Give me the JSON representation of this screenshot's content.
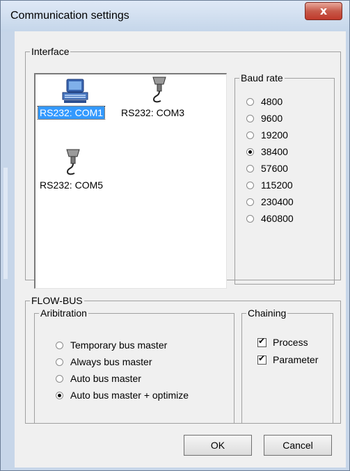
{
  "window": {
    "title": "Communication settings",
    "close_glyph": "x"
  },
  "interface": {
    "legend": "Interface",
    "devices": [
      {
        "label": "RS232: COM1",
        "icon": "computer-icon",
        "selected": true
      },
      {
        "label": "RS232: COM3",
        "icon": "serial-connector-icon",
        "selected": false
      },
      {
        "label": "RS232: COM5",
        "icon": "serial-connector-icon",
        "selected": false
      }
    ]
  },
  "baud_rate": {
    "legend": "Baud rate",
    "options": [
      "4800",
      "9600",
      "19200",
      "38400",
      "57600",
      "115200",
      "230400",
      "460800"
    ],
    "selected": "38400"
  },
  "flowbus": {
    "legend": "FLOW-BUS",
    "arbitration": {
      "legend": "Aribitration",
      "options": [
        "Temporary bus master",
        "Always bus master",
        "Auto bus master",
        "Auto bus master + optimize"
      ],
      "selected": "Auto bus master + optimize"
    },
    "chaining": {
      "legend": "Chaining",
      "options": [
        {
          "label": "Process",
          "checked": true
        },
        {
          "label": "Parameter",
          "checked": true
        }
      ]
    }
  },
  "buttons": {
    "ok": "OK",
    "cancel": "Cancel"
  }
}
